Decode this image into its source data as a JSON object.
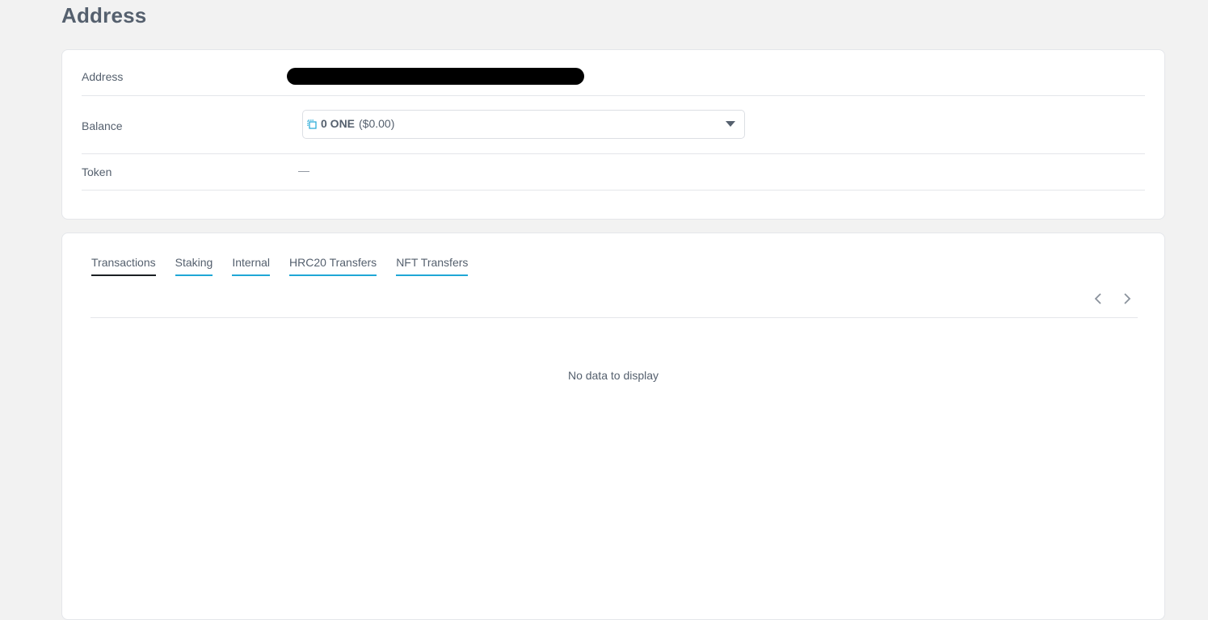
{
  "page": {
    "title": "Address"
  },
  "info": {
    "address_label": "Address",
    "balance_label": "Balance",
    "balance_amount": "0 ONE",
    "balance_usd": "($0.00)",
    "token_label": "Token",
    "token_value": "—"
  },
  "tabs": [
    {
      "label": "Transactions",
      "active": true
    },
    {
      "label": "Staking",
      "active": false
    },
    {
      "label": "Internal",
      "active": false
    },
    {
      "label": "HRC20 Transfers",
      "active": false
    },
    {
      "label": "NFT Transfers",
      "active": false
    }
  ],
  "table": {
    "empty_text": "No data to display"
  },
  "icons": {
    "copy": "copy-icon",
    "dropdown": "caret-down-icon",
    "prev": "chevron-left-icon",
    "next": "chevron-right-icon"
  },
  "colors": {
    "accent": "#1fa7d6",
    "text": "#55606e",
    "background": "#f2f2f2"
  }
}
